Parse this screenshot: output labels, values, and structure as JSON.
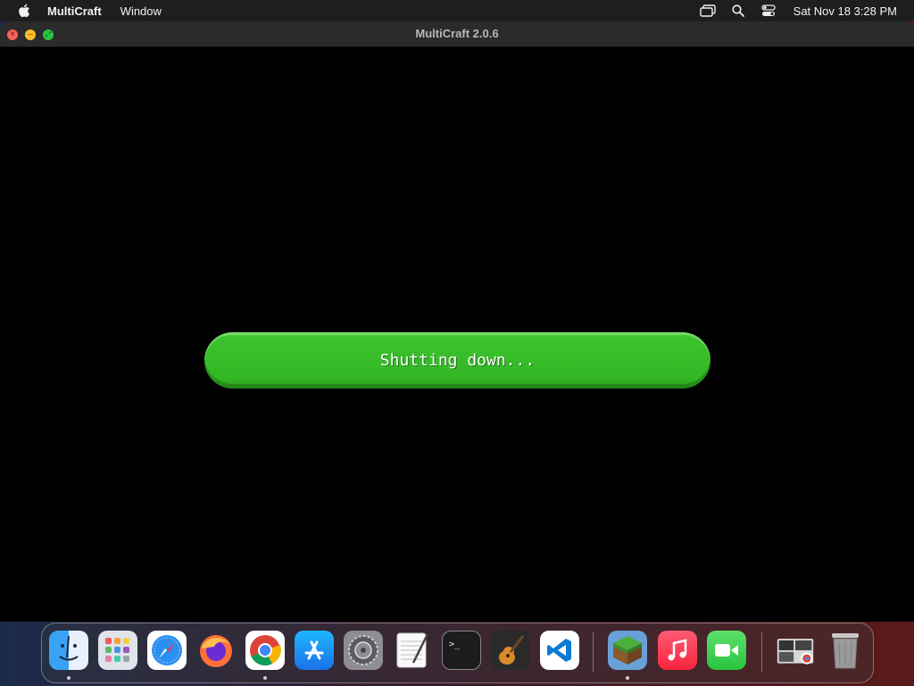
{
  "menubar": {
    "app_name": "MultiCraft",
    "items": [
      "Window"
    ],
    "clock": "Sat Nov 18  3:28 PM",
    "icons": [
      "apple-icon",
      "screen-mirroring-icon",
      "search-icon",
      "control-center-icon"
    ]
  },
  "window": {
    "title": "MultiCraft 2.0.6"
  },
  "status": {
    "label": "Shutting down..."
  },
  "dock": {
    "items": [
      {
        "name": "Finder",
        "icon": "finder-icon",
        "running": true
      },
      {
        "name": "Launchpad",
        "icon": "launchpad-icon",
        "running": false
      },
      {
        "name": "Safari",
        "icon": "safari-icon",
        "running": false
      },
      {
        "name": "Firefox",
        "icon": "firefox-icon",
        "running": false
      },
      {
        "name": "Chrome",
        "icon": "chrome-icon",
        "running": true
      },
      {
        "name": "App Store",
        "icon": "app-store-icon",
        "running": false
      },
      {
        "name": "System Settings",
        "icon": "settings-icon",
        "running": false
      },
      {
        "name": "TextEdit",
        "icon": "textedit-icon",
        "running": false
      },
      {
        "name": "Terminal",
        "icon": "terminal-icon",
        "running": false
      },
      {
        "name": "GarageBand",
        "icon": "garageband-icon",
        "running": false
      },
      {
        "name": "VS Code",
        "icon": "vscode-icon",
        "running": false
      },
      {
        "name": "MultiCraft",
        "icon": "multicraft-icon",
        "running": true
      },
      {
        "name": "Music",
        "icon": "music-icon",
        "running": false
      },
      {
        "name": "FaceTime",
        "icon": "facetime-icon",
        "running": false
      },
      {
        "name": "Downloads",
        "icon": "downloads-stack-icon",
        "running": false
      },
      {
        "name": "Trash",
        "icon": "trash-icon",
        "running": false
      }
    ]
  }
}
